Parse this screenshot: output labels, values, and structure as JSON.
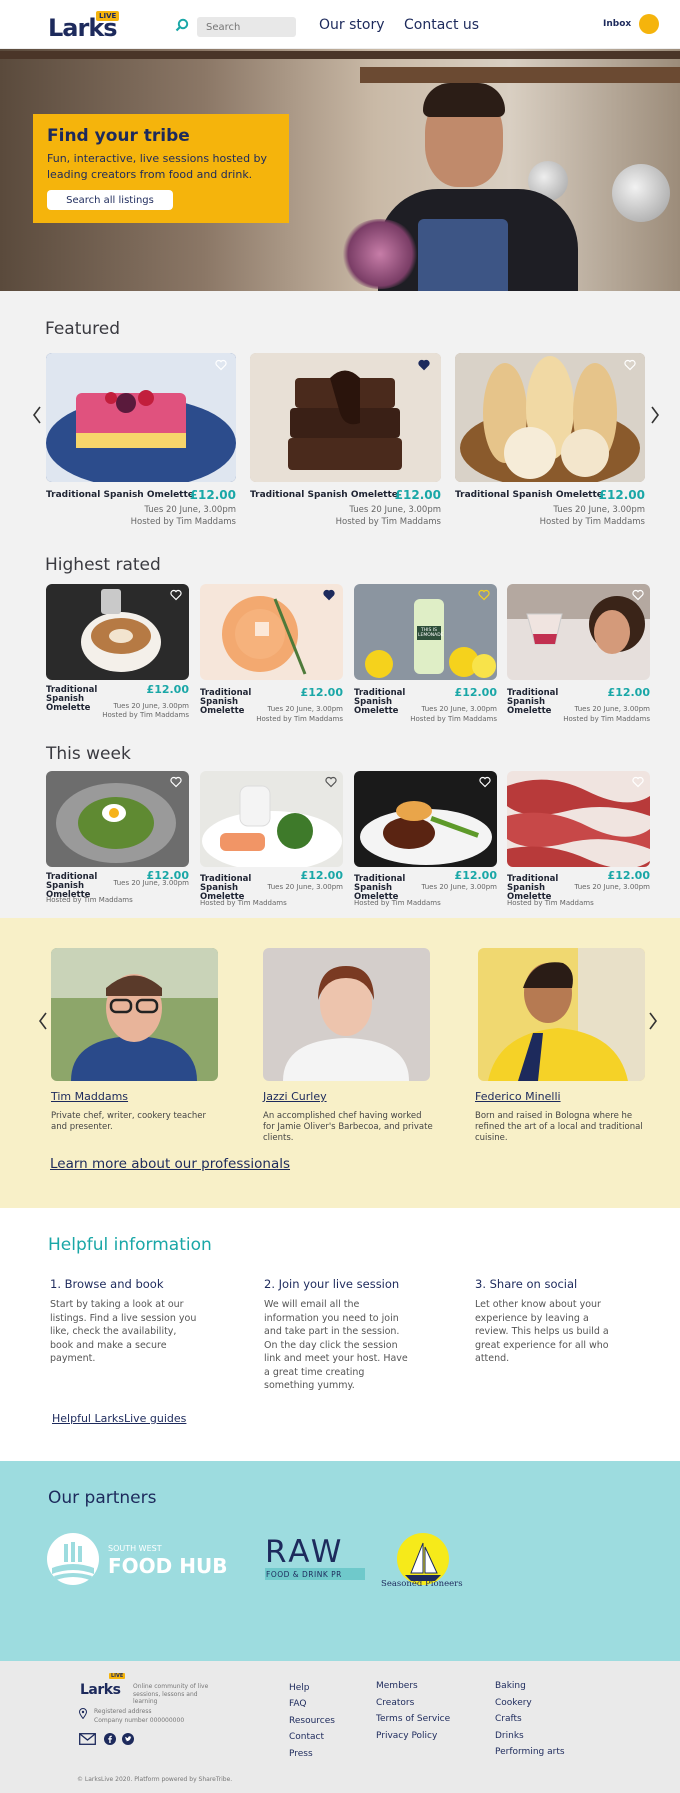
{
  "header": {
    "logo_text": "Larks",
    "logo_badge": "LIVE",
    "search_placeholder": "Search",
    "nav": [
      "Our story",
      "Contact us"
    ],
    "inbox": "Inbox"
  },
  "hero": {
    "title": "Find your tribe",
    "subtitle": "Fun, interactive, live sessions hosted by leading creators from food and drink.",
    "button": "Search all listings"
  },
  "featured": {
    "title": "Featured",
    "cards": [
      {
        "title": "Traditional Spanish Omelette",
        "price": "£12.00",
        "date": "Tues 20 June, 3.00pm",
        "host": "Hosted by Tim Maddams",
        "liked": false
      },
      {
        "title": "Traditional Spanish Omelette",
        "price": "£12.00",
        "date": "Tues 20 June, 3.00pm",
        "host": "Hosted by Tim Maddams",
        "liked": true
      },
      {
        "title": "Traditional Spanish Omelette",
        "price": "£12.00",
        "date": "Tues 20 June, 3.00pm",
        "host": "Hosted by Tim Maddams",
        "liked": false
      }
    ]
  },
  "highest": {
    "title": "Highest rated",
    "cards": [
      {
        "title": "Traditional Spanish Omelette",
        "price": "£12.00",
        "date": "Tues 20 June, 3.00pm",
        "host": "Hosted by Tim Maddams",
        "liked": false
      },
      {
        "title": "Traditional Spanish Omelette",
        "price": "£12.00",
        "date": "Tues 20 June, 3.00pm",
        "host": "Hosted by Tim Maddams",
        "liked": true
      },
      {
        "title": "Traditional Spanish Omelette",
        "price": "£12.00",
        "date": "Tues 20 June, 3.00pm",
        "host": "Hosted by Tim Maddams",
        "liked": false
      },
      {
        "title": "Traditional Spanish Omelette",
        "price": "£12.00",
        "date": "Tues 20 June, 3.00pm",
        "host": "Hosted by Tim Maddams",
        "liked": false
      }
    ],
    "lemonade_label": "THIS IS LEMONADE"
  },
  "week": {
    "title": "This week",
    "cards": [
      {
        "title": "Traditional Spanish Omelette",
        "price": "£12.00",
        "date": "Tues 20 June, 3.00pm",
        "host": "Hosted by Tim Maddams"
      },
      {
        "title": "Traditional Spanish Omelette",
        "price": "£12.00",
        "date": "Tues 20 June, 3.00pm",
        "host": "Hosted by Tim Maddams"
      },
      {
        "title": "Traditional Spanish Omelette",
        "price": "£12.00",
        "date": "Tues 20 June, 3.00pm",
        "host": "Hosted by Tim Maddams"
      },
      {
        "title": "Traditional Spanish Omelette",
        "price": "£12.00",
        "date": "Tues 20 June, 3.00pm",
        "host": "Hosted by Tim Maddams"
      }
    ]
  },
  "pros": {
    "items": [
      {
        "name": "Tim Maddams",
        "desc": "Private chef, writer, cookery teacher and presenter."
      },
      {
        "name": "Jazzi Curley",
        "desc": "An accomplished chef having worked for Jamie Oliver's Barbecoa, and private clients."
      },
      {
        "name": "Federico Minelli",
        "desc": "Born and raised in Bologna where he refined the art of a local and traditional cuisine."
      }
    ],
    "link": "Learn more about our professionals"
  },
  "helpful": {
    "title": "Helpful information",
    "steps": [
      {
        "title": "1. Browse and book",
        "text": "Start by taking a look at our listings. Find a live session you like, check the availability, book and make a secure payment."
      },
      {
        "title": "2. Join your live session",
        "text": "We will email all the information you need to join and take part in the session. On the day click the session link and meet your host. Have a great time creating something yummy."
      },
      {
        "title": "3. Share on social",
        "text": "Let other know about your experience by leaving a review. This helps us build a great experience for all who attend."
      }
    ],
    "guides": "Helpful LarksLive guides"
  },
  "partners": {
    "title": "Our partners",
    "foodhub_small": "SOUTH WEST",
    "foodhub_big": "FOOD HUB",
    "raw_big": "RAW",
    "raw_small": "FOOD & DRINK PR",
    "pioneers": "Seasoned Pioneers"
  },
  "footer": {
    "logo_text": "Larks",
    "logo_badge": "LIVE",
    "tagline": "Online community of live sessions, lessons and learning",
    "address1": "Registered address",
    "address2": "Company number 000000000",
    "col1": [
      "Help",
      "FAQ",
      "Resources",
      "Contact",
      "Press"
    ],
    "col2": [
      "Members",
      "Creators",
      "Terms of Service",
      "Privacy Policy"
    ],
    "col3": [
      "Baking",
      "Cookery",
      "Crafts",
      "Drinks",
      "Performing arts"
    ],
    "copyright": "© LarksLive 2020. Platform powered by ShareTribe."
  },
  "colors": {
    "brand": "#1d2a5c",
    "accent": "#f5b40c",
    "teal": "#1aa7a7"
  }
}
